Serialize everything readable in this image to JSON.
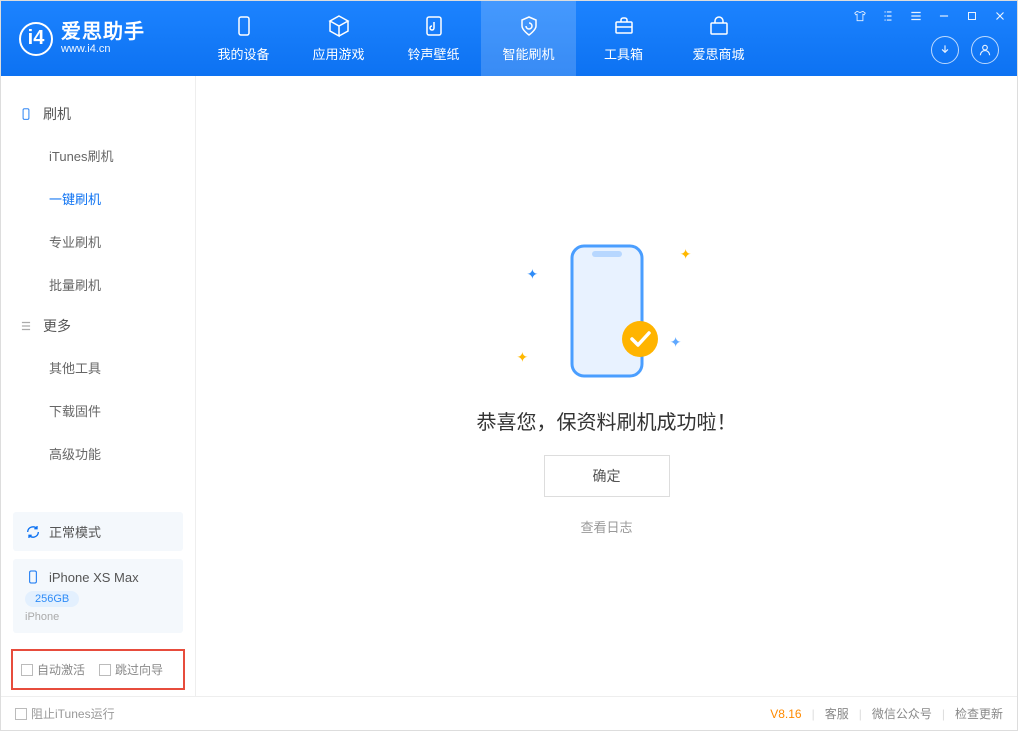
{
  "app": {
    "title": "爱思助手",
    "subtitle": "www.i4.cn"
  },
  "tabs": [
    {
      "label": "我的设备"
    },
    {
      "label": "应用游戏"
    },
    {
      "label": "铃声壁纸"
    },
    {
      "label": "智能刷机"
    },
    {
      "label": "工具箱"
    },
    {
      "label": "爱思商城"
    }
  ],
  "sidebar": {
    "section1_title": "刷机",
    "section1_items": [
      "iTunes刷机",
      "一键刷机",
      "专业刷机",
      "批量刷机"
    ],
    "section2_title": "更多",
    "section2_items": [
      "其他工具",
      "下载固件",
      "高级功能"
    ]
  },
  "device": {
    "mode_label": "正常模式",
    "name": "iPhone XS Max",
    "storage": "256GB",
    "type": "iPhone"
  },
  "options": {
    "auto_activate": "自动激活",
    "skip_wizard": "跳过向导"
  },
  "footer": {
    "block_itunes": "阻止iTunes运行",
    "version": "V8.16",
    "links": [
      "客服",
      "微信公众号",
      "检查更新"
    ]
  },
  "main": {
    "success_msg": "恭喜您，保资料刷机成功啦！",
    "ok_btn": "确定",
    "log_link": "查看日志"
  }
}
